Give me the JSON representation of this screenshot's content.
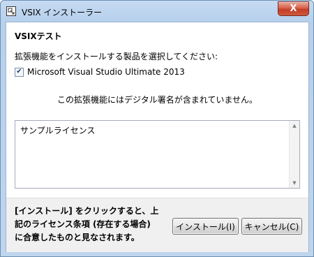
{
  "window": {
    "title": "VSIX インストーラー",
    "close_symbol": "X"
  },
  "extension": {
    "name": "VSIXテスト"
  },
  "instruction": "拡張機能をインストールする製品を選択してください:",
  "products": [
    {
      "label": "Microsoft Visual Studio Ultimate 2013",
      "checked": true,
      "check_symbol": "✔"
    }
  ],
  "signature_warning": "この拡張機能にはデジタル署名が含まれていません。",
  "license": {
    "text": "サンプルライセンス",
    "scroll_up_symbol": "▲",
    "scroll_down_symbol": "▼"
  },
  "footer": {
    "notice": "[インストール] をクリックすると、上記のライセンス条項 (存在する場合) に合意したものと見なされます。",
    "install_label": "インストール(I)",
    "cancel_label": "キャンセル(C)"
  },
  "colors": {
    "close_button": "#c23e27",
    "title_bar": "#b7d0ec"
  }
}
